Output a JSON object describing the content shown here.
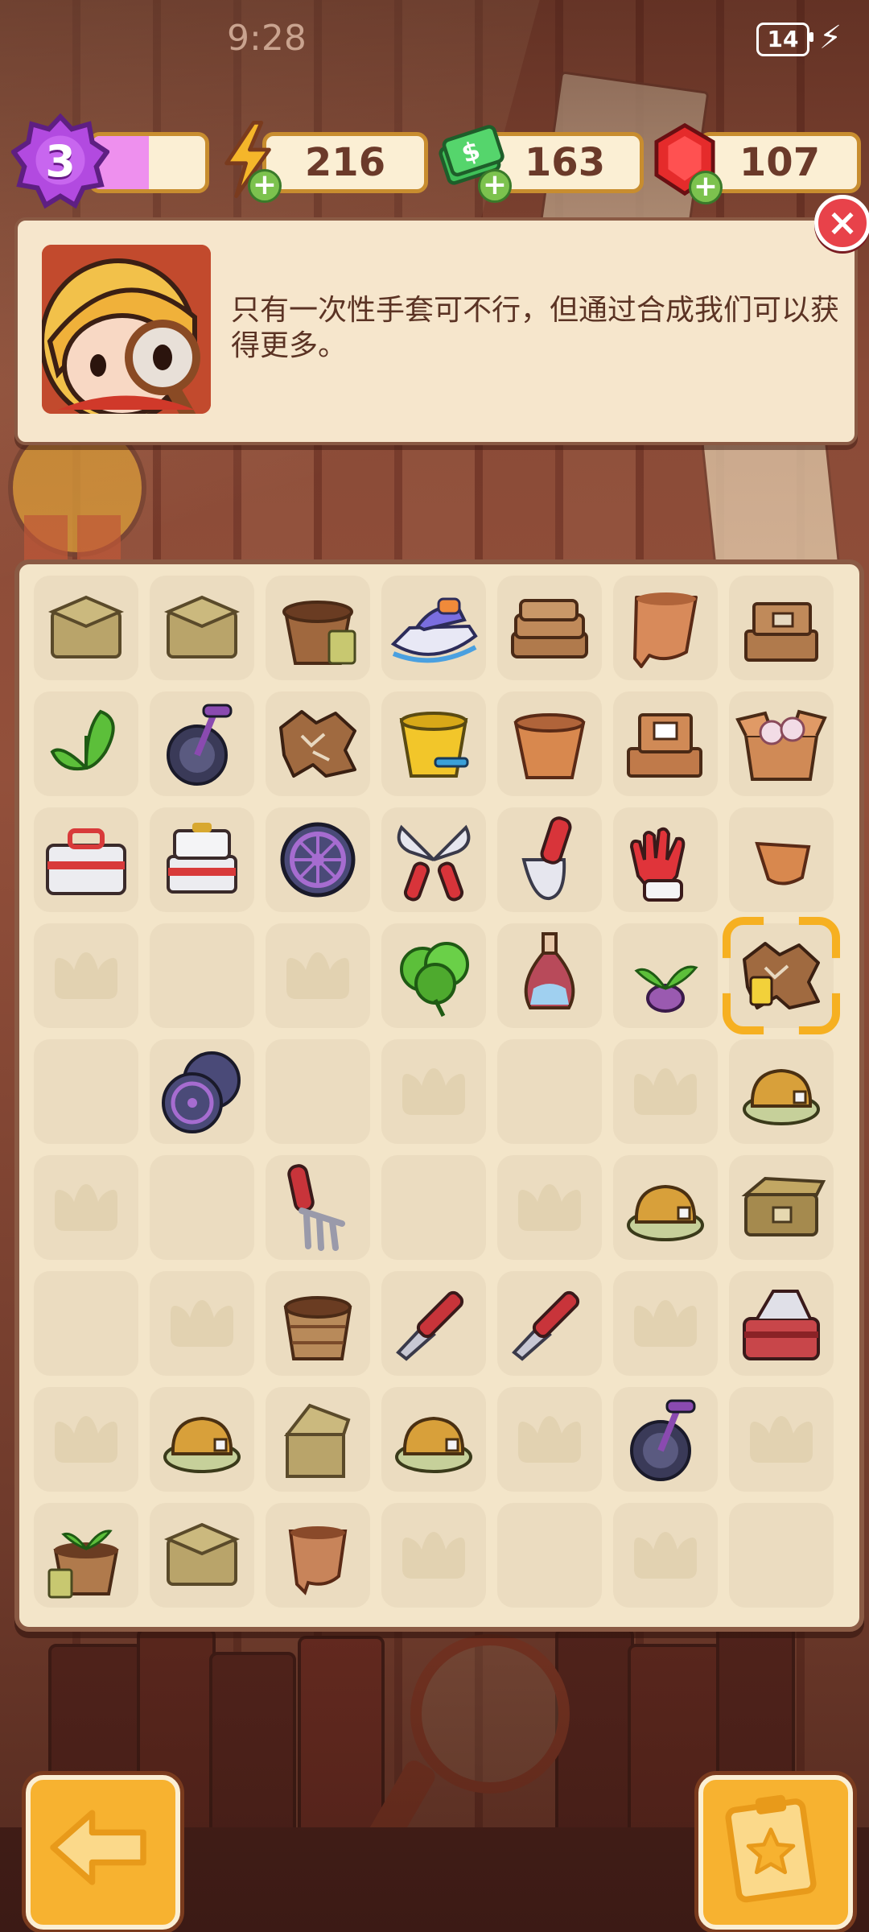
{
  "status_bar": {
    "time": "9:28",
    "battery": "14"
  },
  "resources": {
    "level": "3",
    "level_progress": 0.5,
    "energy": "216",
    "cash": "163",
    "gems": "107"
  },
  "dialog": {
    "text": "只有一次性手套可不行，但通过合成我们可以获得更多。",
    "close_icon": "close-icon"
  },
  "board": {
    "rows": 9,
    "cols": 7,
    "cells": [
      [
        "box-closed",
        "box-closed",
        "flowerpot-seed-packet",
        "jet-ski",
        "flat-boxes",
        "broken-pot",
        "box-stack"
      ],
      [
        "plant-sprout",
        "unicycle",
        "dirt-scraps",
        "yellow-bucket",
        "clay-pot",
        "box-stack-open",
        "box-open-pots"
      ],
      [
        "toolbox-white",
        "toolbox-open",
        "wheel",
        "pruning-shears",
        "trowel-red",
        "rubber-glove",
        "pot-shard"
      ],
      [
        "empty",
        "blank",
        "empty",
        "leafy-plant",
        "vase",
        "seedling",
        "dirt-scraps-selected"
      ],
      [
        "blank",
        "wheels",
        "blank",
        "empty",
        "blank",
        "empty",
        "cap"
      ],
      [
        "empty",
        "blank",
        "hand-rake",
        "blank",
        "empty",
        "cap",
        "box-closed-wood"
      ],
      [
        "blank",
        "empty",
        "wicker-pot",
        "trowel",
        "trowel",
        "empty",
        "toolbox-red"
      ],
      [
        "empty",
        "cap",
        "box-open-lid",
        "cap",
        "empty",
        "unicycle",
        "empty"
      ],
      [
        "potted-sprout",
        "box-closed",
        "broken-pot-small",
        "empty",
        "blank",
        "empty",
        "blank"
      ]
    ]
  },
  "buttons": {
    "back_icon": "back-arrow-icon",
    "tasks_icon": "clipboard-star-icon"
  },
  "colors": {
    "accent": "#f7b230",
    "board": "#f3e5c9",
    "cell": "#ebdcc0",
    "text": "#5b3324"
  }
}
